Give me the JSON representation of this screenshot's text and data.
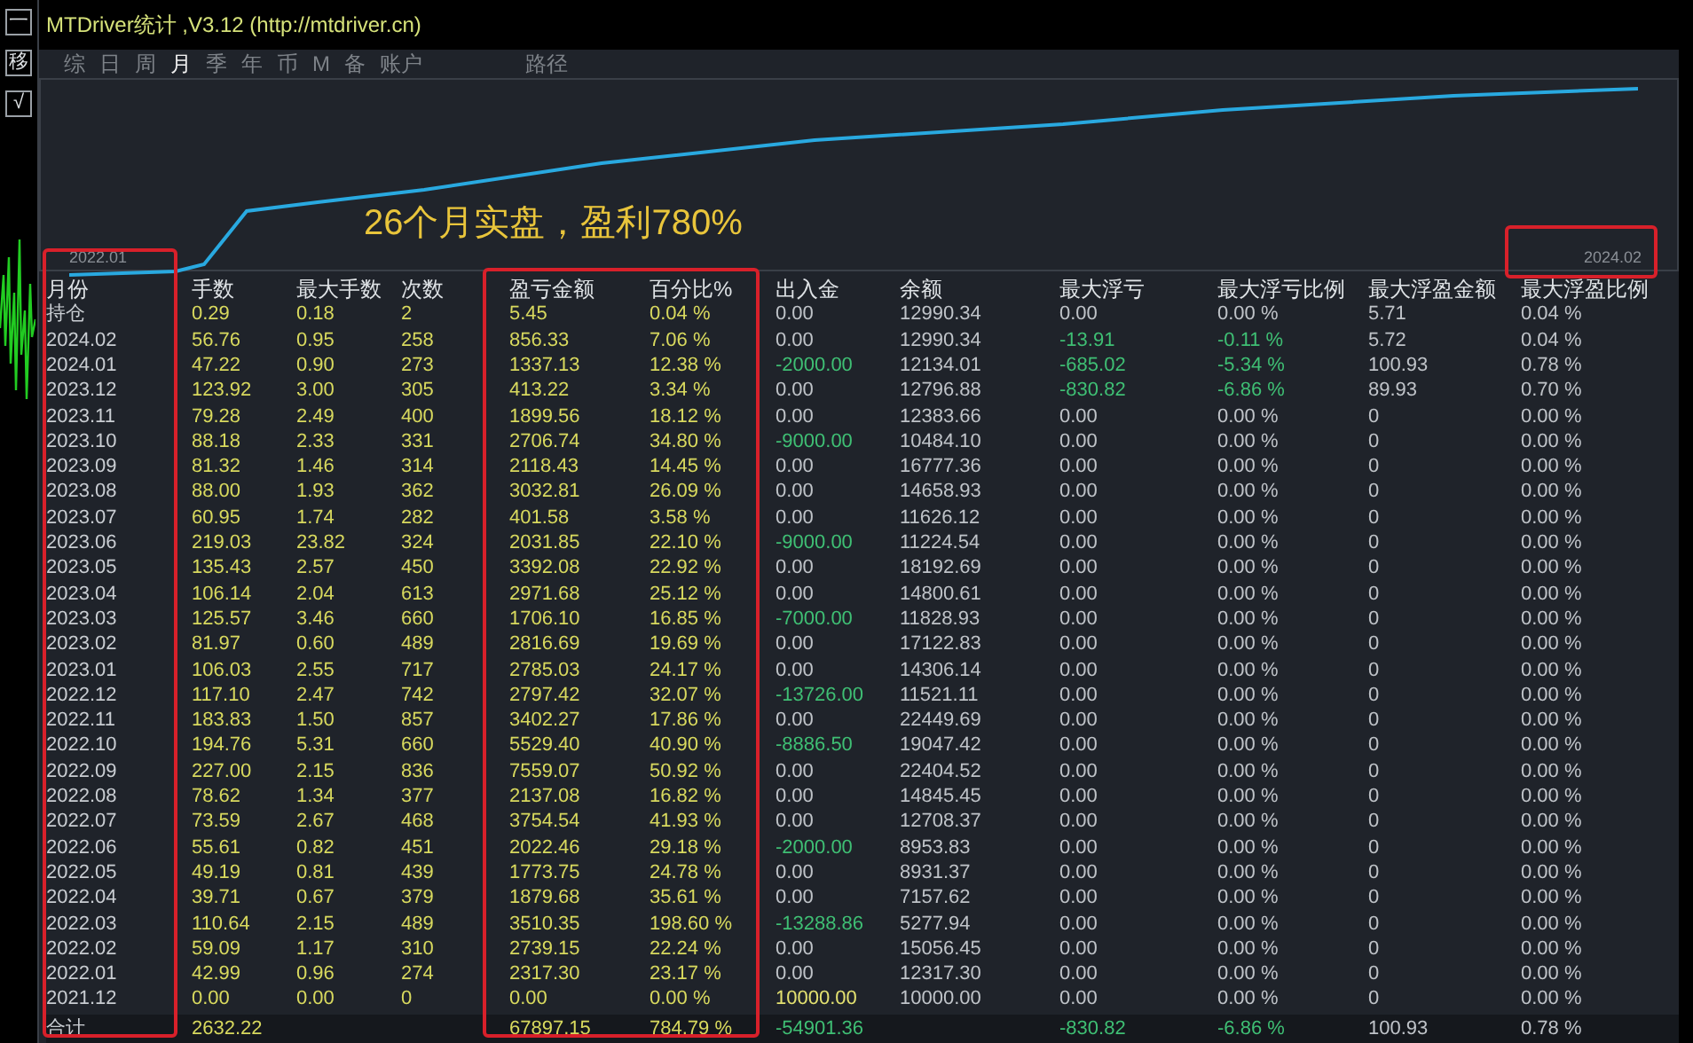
{
  "window": {
    "title": "MTDriver统计 ,V3.12 (http://mtdriver.cn)"
  },
  "side_buttons": [
    "一",
    "移",
    "√"
  ],
  "tabs": [
    {
      "label": "综",
      "selected": false
    },
    {
      "label": "日",
      "selected": false
    },
    {
      "label": "周",
      "selected": false
    },
    {
      "label": "月",
      "selected": true
    },
    {
      "label": "季",
      "selected": false
    },
    {
      "label": "年",
      "selected": false
    },
    {
      "label": "币",
      "selected": false
    },
    {
      "label": "M",
      "selected": false
    },
    {
      "label": "备",
      "selected": false
    },
    {
      "label": "账户",
      "selected": false
    }
  ],
  "path_button": "路径",
  "chart": {
    "annotation": "26个月实盘，盈利780%",
    "start_label": "2022.01",
    "end_label": "2024.02"
  },
  "table": {
    "columns": [
      "月份",
      "手数",
      "最大手数",
      "次数",
      "盈亏金额",
      "百分比%",
      "出入金",
      "余额",
      "最大浮亏",
      "最大浮亏比例",
      "最大浮盈金额",
      "最大浮盈比例"
    ],
    "rows": [
      [
        "持仓",
        "0.29",
        "0.18",
        "2",
        "5.45",
        "0.04 %",
        "0.00",
        "12990.34",
        "0.00",
        "0.00 %",
        "5.71",
        "0.04 %"
      ],
      [
        "2024.02",
        "56.76",
        "0.95",
        "258",
        "856.33",
        "7.06 %",
        "0.00",
        "12990.34",
        {
          "text": "-13.91",
          "color": "#3fbf74"
        },
        {
          "text": "-0.11 %",
          "color": "#3fbf74"
        },
        "5.72",
        "0.04 %"
      ],
      [
        "2024.01",
        "47.22",
        "0.90",
        "273",
        "1337.13",
        "12.38 %",
        {
          "text": "-2000.00",
          "color": "#3fbf74"
        },
        "12134.01",
        {
          "text": "-685.02",
          "color": "#3fbf74"
        },
        {
          "text": "-5.34 %",
          "color": "#3fbf74"
        },
        "100.93",
        "0.78 %"
      ],
      [
        "2023.12",
        "123.92",
        "3.00",
        "305",
        "413.22",
        "3.34 %",
        "0.00",
        "12796.88",
        {
          "text": "-830.82",
          "color": "#3fbf74"
        },
        {
          "text": "-6.86 %",
          "color": "#3fbf74"
        },
        "89.93",
        "0.70 %"
      ],
      [
        "2023.11",
        "79.28",
        "2.49",
        "400",
        "1899.56",
        "18.12 %",
        "0.00",
        "12383.66",
        "0.00",
        "0.00 %",
        "0",
        "0.00 %"
      ],
      [
        "2023.10",
        "88.18",
        "2.33",
        "331",
        "2706.74",
        "34.80 %",
        {
          "text": "-9000.00",
          "color": "#3fbf74"
        },
        "10484.10",
        "0.00",
        "0.00 %",
        "0",
        "0.00 %"
      ],
      [
        "2023.09",
        "81.32",
        "1.46",
        "314",
        "2118.43",
        "14.45 %",
        "0.00",
        "16777.36",
        "0.00",
        "0.00 %",
        "0",
        "0.00 %"
      ],
      [
        "2023.08",
        "88.00",
        "1.93",
        "362",
        "3032.81",
        "26.09 %",
        "0.00",
        "14658.93",
        "0.00",
        "0.00 %",
        "0",
        "0.00 %"
      ],
      [
        "2023.07",
        "60.95",
        "1.74",
        "282",
        "401.58",
        "3.58 %",
        "0.00",
        "11626.12",
        "0.00",
        "0.00 %",
        "0",
        "0.00 %"
      ],
      [
        "2023.06",
        "219.03",
        "23.82",
        "324",
        "2031.85",
        "22.10 %",
        {
          "text": "-9000.00",
          "color": "#3fbf74"
        },
        "11224.54",
        "0.00",
        "0.00 %",
        "0",
        "0.00 %"
      ],
      [
        "2023.05",
        "135.43",
        "2.57",
        "450",
        "3392.08",
        "22.92 %",
        "0.00",
        "18192.69",
        "0.00",
        "0.00 %",
        "0",
        "0.00 %"
      ],
      [
        "2023.04",
        "106.14",
        "2.04",
        "613",
        "2971.68",
        "25.12 %",
        "0.00",
        "14800.61",
        "0.00",
        "0.00 %",
        "0",
        "0.00 %"
      ],
      [
        "2023.03",
        "125.57",
        "3.46",
        "660",
        "1706.10",
        "16.85 %",
        {
          "text": "-7000.00",
          "color": "#3fbf74"
        },
        "11828.93",
        "0.00",
        "0.00 %",
        "0",
        "0.00 %"
      ],
      [
        "2023.02",
        "81.97",
        "0.60",
        "489",
        "2816.69",
        "19.69 %",
        "0.00",
        "17122.83",
        "0.00",
        "0.00 %",
        "0",
        "0.00 %"
      ],
      [
        "2023.01",
        "106.03",
        "2.55",
        "717",
        "2785.03",
        "24.17 %",
        "0.00",
        "14306.14",
        "0.00",
        "0.00 %",
        "0",
        "0.00 %"
      ],
      [
        "2022.12",
        "117.10",
        "2.47",
        "742",
        "2797.42",
        "32.07 %",
        {
          "text": "-13726.00",
          "color": "#3fbf74"
        },
        "11521.11",
        "0.00",
        "0.00 %",
        "0",
        "0.00 %"
      ],
      [
        "2022.11",
        "183.83",
        "1.50",
        "857",
        "3402.27",
        "17.86 %",
        "0.00",
        "22449.69",
        "0.00",
        "0.00 %",
        "0",
        "0.00 %"
      ],
      [
        "2022.10",
        "194.76",
        "5.31",
        "660",
        "5529.40",
        "40.90 %",
        {
          "text": "-8886.50",
          "color": "#3fbf74"
        },
        "19047.42",
        "0.00",
        "0.00 %",
        "0",
        "0.00 %"
      ],
      [
        "2022.09",
        "227.00",
        "2.15",
        "836",
        "7559.07",
        "50.92 %",
        "0.00",
        "22404.52",
        "0.00",
        "0.00 %",
        "0",
        "0.00 %"
      ],
      [
        "2022.08",
        "78.62",
        "1.34",
        "377",
        "2137.08",
        "16.82 %",
        "0.00",
        "14845.45",
        "0.00",
        "0.00 %",
        "0",
        "0.00 %"
      ],
      [
        "2022.07",
        "73.59",
        "2.67",
        "468",
        "3754.54",
        "41.93 %",
        "0.00",
        "12708.37",
        "0.00",
        "0.00 %",
        "0",
        "0.00 %"
      ],
      [
        "2022.06",
        "55.61",
        "0.82",
        "451",
        "2022.46",
        "29.18 %",
        {
          "text": "-2000.00",
          "color": "#3fbf74"
        },
        "8953.83",
        "0.00",
        "0.00 %",
        "0",
        "0.00 %"
      ],
      [
        "2022.05",
        "49.19",
        "0.81",
        "439",
        "1773.75",
        "24.78 %",
        "0.00",
        "8931.37",
        "0.00",
        "0.00 %",
        "0",
        "0.00 %"
      ],
      [
        "2022.04",
        "39.71",
        "0.67",
        "379",
        "1879.68",
        "35.61 %",
        "0.00",
        "7157.62",
        "0.00",
        "0.00 %",
        "0",
        "0.00 %"
      ],
      [
        "2022.03",
        "110.64",
        "2.15",
        "489",
        "3510.35",
        "198.60 %",
        {
          "text": "-13288.86",
          "color": "#3fbf74"
        },
        "5277.94",
        "0.00",
        "0.00 %",
        "0",
        "0.00 %"
      ],
      [
        "2022.02",
        "59.09",
        "1.17",
        "310",
        "2739.15",
        "22.24 %",
        "0.00",
        "15056.45",
        "0.00",
        "0.00 %",
        "0",
        "0.00 %"
      ],
      [
        "2022.01",
        "42.99",
        "0.96",
        "274",
        "2317.30",
        "23.17 %",
        "0.00",
        "12317.30",
        "0.00",
        "0.00 %",
        "0",
        "0.00 %"
      ],
      [
        "2021.12",
        "0.00",
        "0.00",
        "0",
        "0.00",
        "0.00 %",
        {
          "text": "10000.00",
          "color": "#e2e070"
        },
        "10000.00",
        "0.00",
        "0.00 %",
        "0",
        "0.00 %"
      ]
    ],
    "total": {
      "label": "合计",
      "lots": "2632.22",
      "profit": "67897.15",
      "percent": "784.79 %",
      "deposit": {
        "text": "-54901.36",
        "color": "#3fbf74"
      },
      "max_float_loss": {
        "text": "-830.82",
        "color": "#3fbf74"
      },
      "max_float_loss_pct": {
        "text": "-6.86 %",
        "color": "#3fbf74"
      },
      "max_float_profit": "100.93",
      "max_float_profit_pct": "0.78 %"
    }
  }
}
